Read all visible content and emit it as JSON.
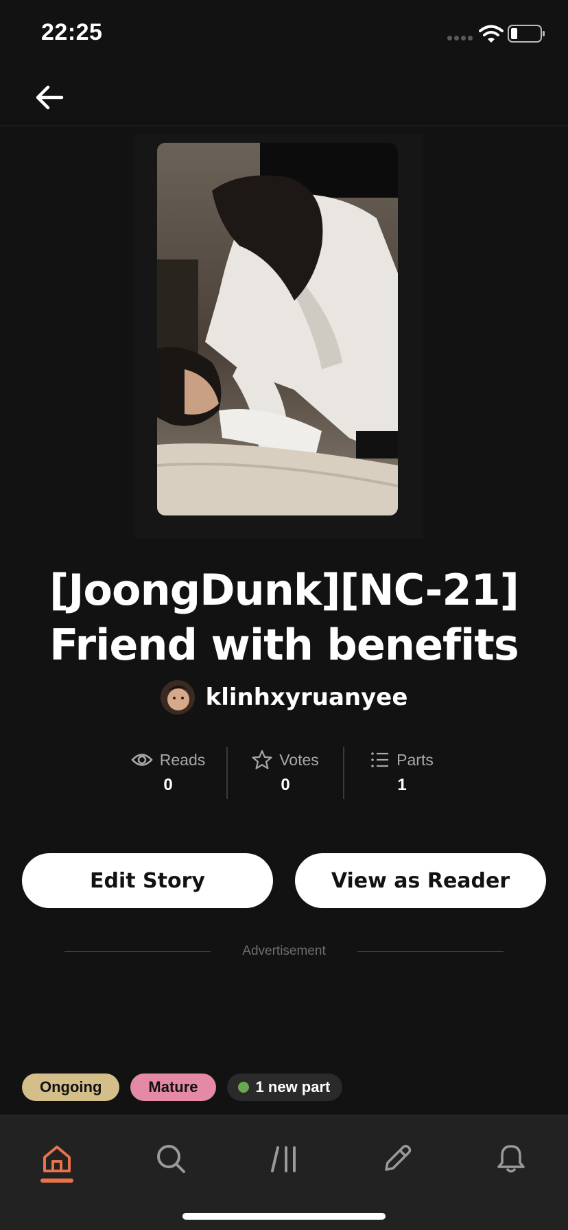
{
  "status_bar": {
    "time": "22:25"
  },
  "story": {
    "title_line1": "[JoongDunk][NC-21]",
    "title_line2": "Friend with benefits",
    "author": "klinhxyruanyee"
  },
  "stats": [
    {
      "label": "Reads",
      "value": "0",
      "icon": "eye-icon"
    },
    {
      "label": "Votes",
      "value": "0",
      "icon": "star-icon"
    },
    {
      "label": "Parts",
      "value": "1",
      "icon": "list-icon"
    }
  ],
  "actions": {
    "edit_label": "Edit Story",
    "read_label": "View as Reader"
  },
  "ad": {
    "label": "Advertisement"
  },
  "tags": {
    "ongoing": "Ongoing",
    "mature": "Mature",
    "new_parts": "1 new part"
  },
  "colors": {
    "background": "#121212",
    "accent": "#e8734a",
    "ongoing": "#d4be8a",
    "mature": "#e58aa5",
    "new_dot": "#6aa84f"
  },
  "nav": {
    "items": [
      "home-icon",
      "search-icon",
      "library-icon",
      "pencil-icon",
      "bell-icon"
    ],
    "active": "home-icon"
  }
}
